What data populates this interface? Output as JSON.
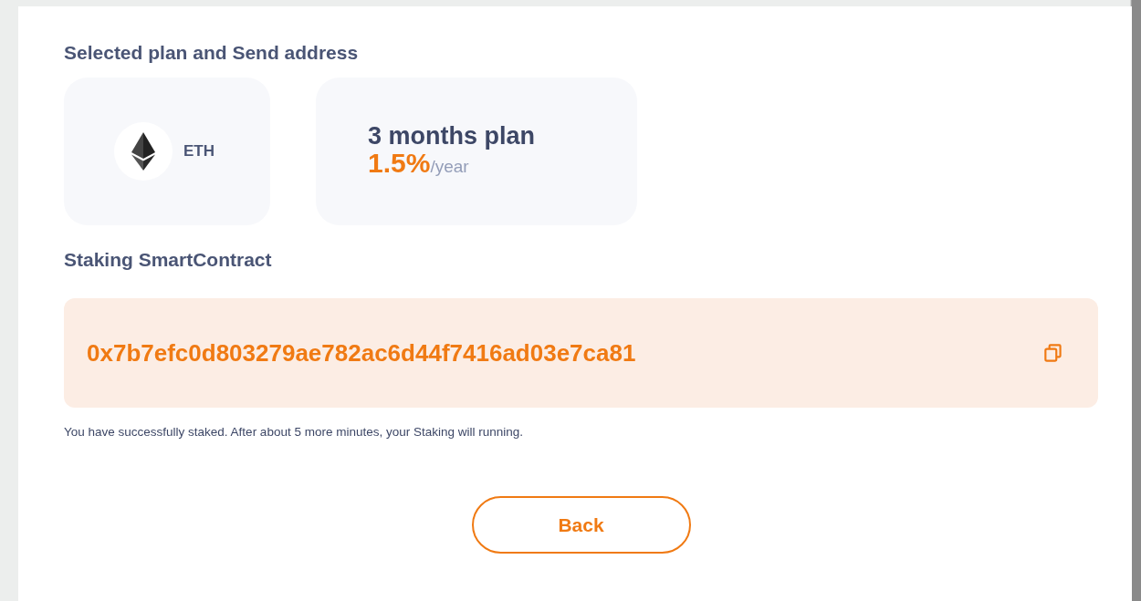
{
  "plan_section": {
    "title": "Selected plan and Send address"
  },
  "coin": {
    "symbol": "ETH"
  },
  "plan": {
    "name": "3 months plan",
    "rate": "1.5%",
    "period": "/year"
  },
  "contract_section": {
    "title": "Staking SmartContract",
    "address": "0x7b7efc0d803279ae782ac6d44f7416ad03e7ca81"
  },
  "message": "You have successfully staked. After about 5 more minutes, your Staking will running.",
  "buttons": [
    "Back"
  ]
}
